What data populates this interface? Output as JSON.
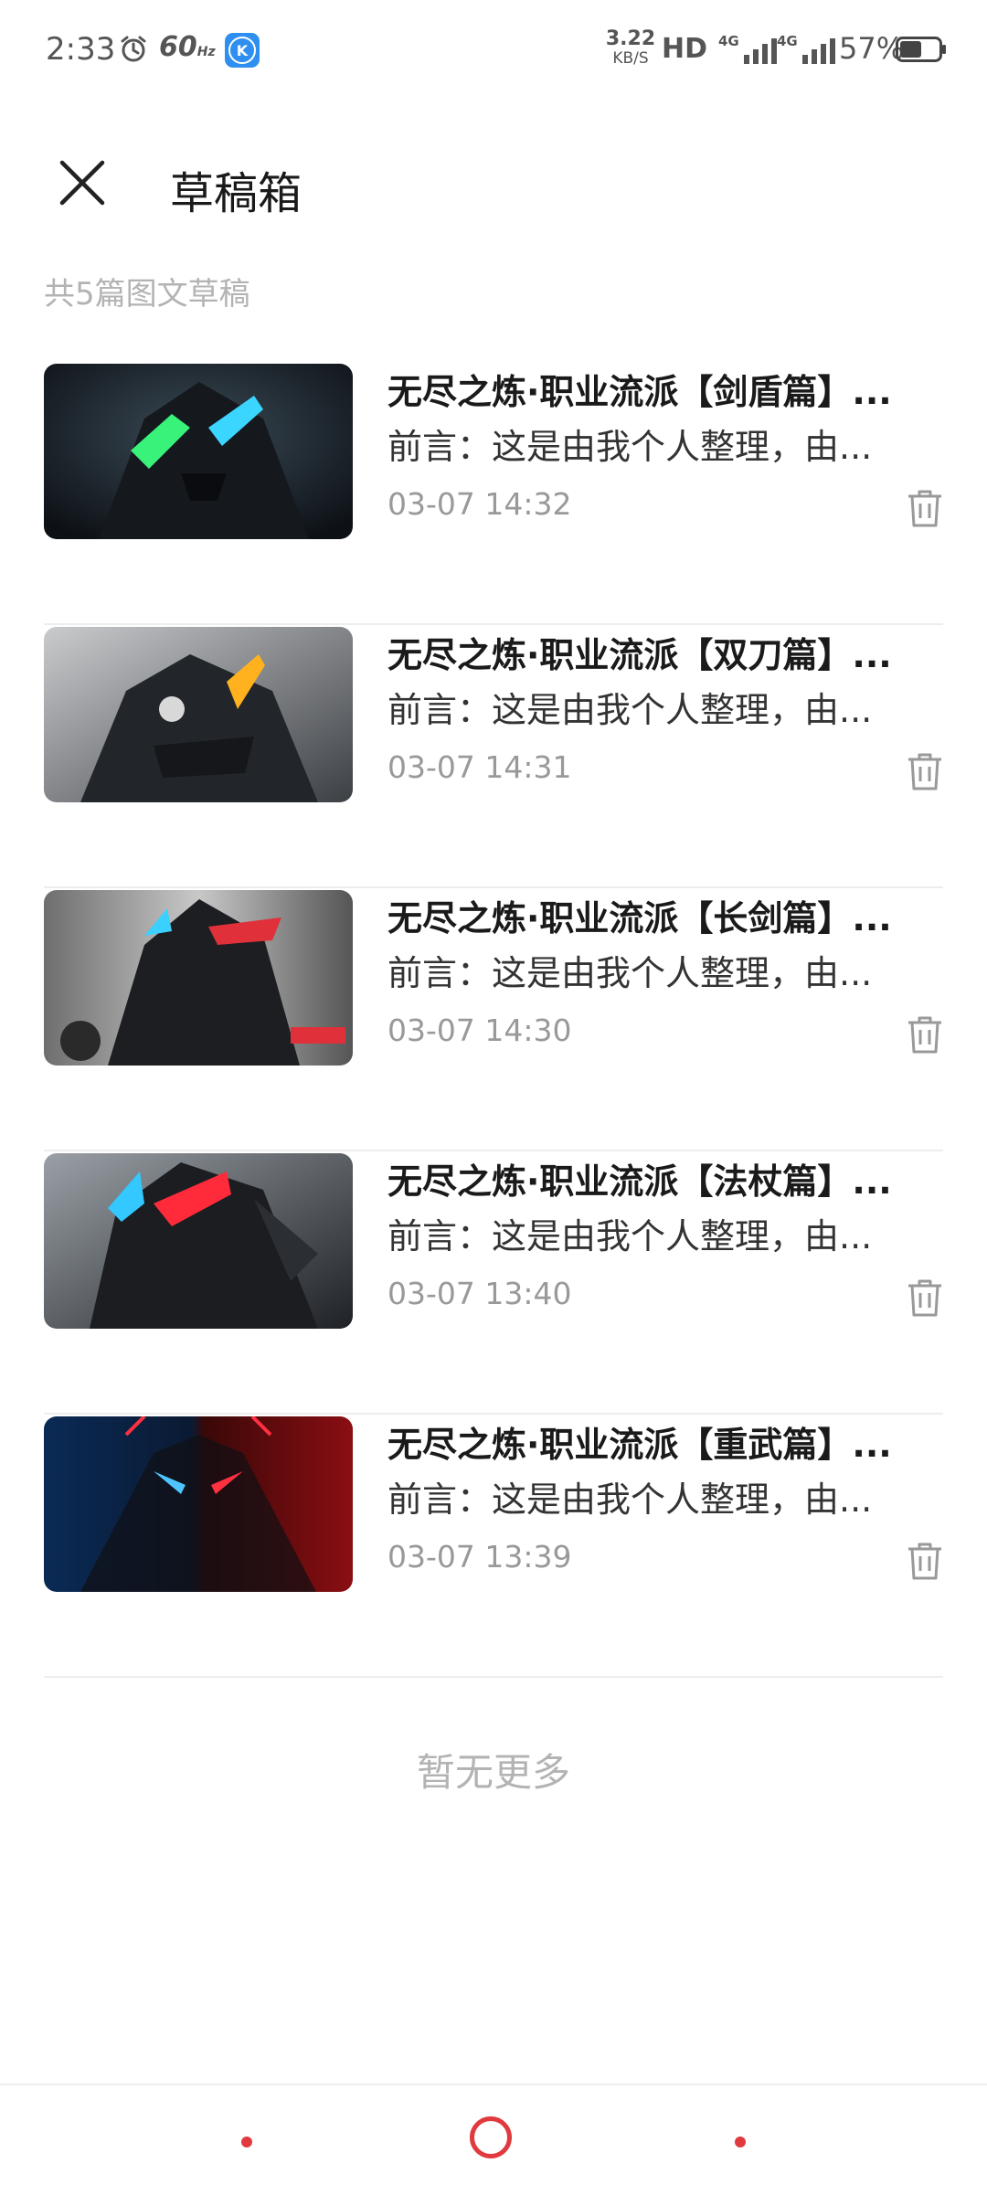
{
  "status_bar": {
    "time": "2:33",
    "refresh_rate": "60",
    "refresh_unit": "Hz",
    "app_badge": "K",
    "net_speed_value": "3.22",
    "net_speed_unit": "KB/S",
    "hd_label": "HD",
    "net1_label": "4G",
    "net2_label": "4G",
    "battery_percent": "57%",
    "battery_level": 0.57
  },
  "header": {
    "title": "草稿箱"
  },
  "summary": "共5篇图文草稿",
  "drafts": [
    {
      "title": "无尽之炼·职业流派【剑盾篇】...",
      "excerpt": "前言：这是由我个人整理，由...",
      "time": "03-07 14:32"
    },
    {
      "title": "无尽之炼·职业流派【双刀篇】...",
      "excerpt": "前言：这是由我个人整理，由...",
      "time": "03-07 14:31"
    },
    {
      "title": "无尽之炼·职业流派【长剑篇】...",
      "excerpt": "前言：这是由我个人整理，由...",
      "time": "03-07 14:30"
    },
    {
      "title": "无尽之炼·职业流派【法杖篇】...",
      "excerpt": "前言：这是由我个人整理，由...",
      "time": "03-07 13:40"
    },
    {
      "title": "无尽之炼·职业流派【重武篇】...",
      "excerpt": "前言：这是由我个人整理，由...",
      "time": "03-07 13:39"
    }
  ],
  "no_more_text": "暂无更多",
  "colors": {
    "accent": "#e03a3e",
    "muted_text": "#b3b3b3",
    "divider": "#ededed"
  }
}
